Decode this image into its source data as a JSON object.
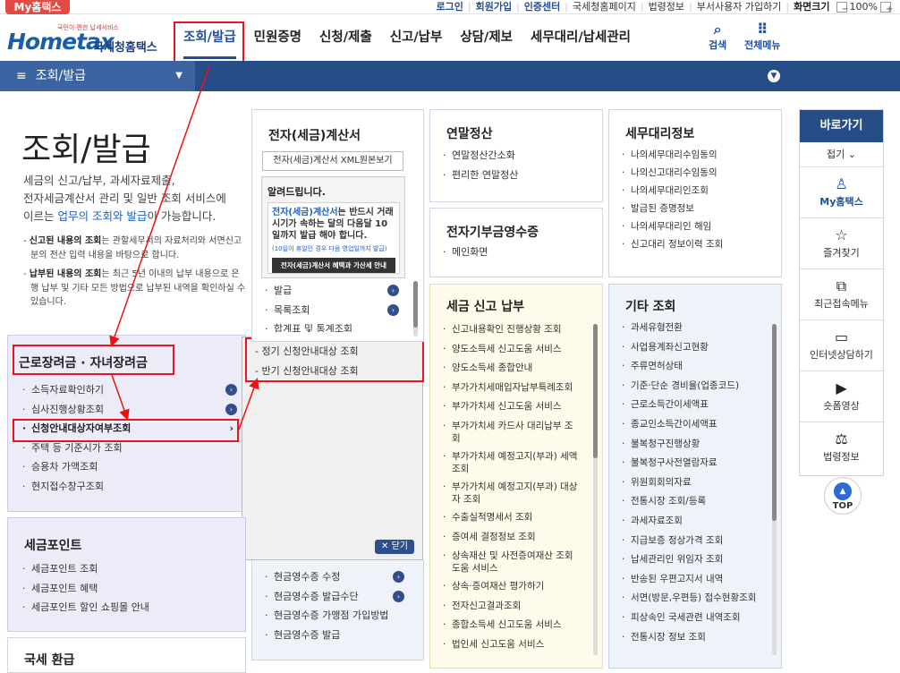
{
  "topbar": {
    "brand": "My홈택스",
    "links": [
      "로그인",
      "회원가입",
      "인증센터",
      "국세청홈페이지",
      "법령정보",
      "부서사용자 가입하기",
      "화면크기"
    ],
    "zoom": "100%",
    "zoom_out": "−",
    "zoom_in": "+"
  },
  "header": {
    "logo_small": "국민이 편한 납세서비스",
    "logo_main": "Hometax",
    "logo_sub": "국세청홈택스",
    "menu": [
      "조회/발급",
      "민원증명",
      "신청/제출",
      "신고/납부",
      "상담/제보",
      "세무대리/납세관리"
    ],
    "search_label": "검색",
    "allmenu_label": "전체메뉴"
  },
  "navbar": {
    "crumb": "조회/발급"
  },
  "page": {
    "title": "조회/발급",
    "desc_1": "세금의 신고/납부, 과세자료제출,",
    "desc_2": "전자세금계산서 관리 및 일반 조회 서비스에",
    "desc_3a": "이르는 ",
    "desc_3b": "업무의 조회와 발급",
    "desc_3c": "이 가능합니다.",
    "note1_bold": "신고된 내용의 조회",
    "note1_rest": "는 관할세무서의 자료처리와 서면신고분의 전산 입력 내용을 바탕으로 합니다.",
    "note2_bold": "납부된 내용의 조회",
    "note2_rest": "는 최근 5년 이내의 납부 내용으로 은행 납부 및 기타 모든 방법으로 납부된 내역을 확인하실 수 있습니다."
  },
  "box_labor": {
    "title": "근로장려금 · 자녀장려금",
    "items": [
      "소득자료확인하기",
      "심사진행상황조회",
      "신청안내대상자여부조회",
      "주택 등 기준시가 조회",
      "승용차 가액조회",
      "현지접수창구조회"
    ]
  },
  "popup": {
    "items": [
      "- 정기 신청안내대상 조회",
      "- 반기 신청안내대상 조회"
    ],
    "close": "닫기"
  },
  "box_point": {
    "title": "세금포인트",
    "items": [
      "세금포인트 조회",
      "세금포인트 혜택",
      "세금포인트 할인 쇼핑몰 안내"
    ]
  },
  "box_refund": {
    "title": "국세 환급"
  },
  "box_einvoice": {
    "title": "전자(세금)계산서",
    "xml_btn": "전자(세금)계산서 XML원본보기",
    "notice_title": "알려드립니다.",
    "notice_line1a": "전자(세금)계산서",
    "notice_line1b": "는 반드시 거래시기가 속하는 달의 다음달 10일까지 발급 해야 합니다.",
    "notice_small": "(10일이 휴일인 경우 다음 영업일까지 발급)",
    "notice_dark": "전자(세금)계산서 혜택과 가산세 안내",
    "items": [
      "발급",
      "목록조회",
      "합계표 및 통계조회"
    ]
  },
  "box_cash": {
    "items": [
      "현금영수증 수정",
      "현금영수증 발급수단",
      "현금영수증 가맹점 가입방법",
      "현금영수증 발급"
    ]
  },
  "box_yearend": {
    "title": "연말정산",
    "items": [
      "연말정산간소화",
      "편리한 연말정산"
    ]
  },
  "box_donation": {
    "title": "전자기부금영수증",
    "items": [
      "메인화면"
    ]
  },
  "box_taxreport": {
    "title": "세금 신고 납부",
    "items": [
      "신고내용확인 진행상황 조회",
      "양도소득세 신고도움 서비스",
      "양도소득세 종합안내",
      "부가가치세매입자납부특례조회",
      "부가가치세 신고도움 서비스",
      "부가가치세 카드사 대리납부 조회",
      "부가가치세 예정고지(부과) 세액조회",
      "부가가치세 예정고지(부과) 대상자 조회",
      "수출실적명세서 조회",
      "증여세 결정정보 조회",
      "상속재산 및 사전증여재산 조회 도움 서비스",
      "상속·증여재산 평가하기",
      "전자신고결과조회",
      "종합소득세 신고도움 서비스",
      "법인세 신고도움 서비스"
    ]
  },
  "box_agent": {
    "title": "세무대리정보",
    "items": [
      "나의세무대리수임동의",
      "나의신고대리수임동의",
      "나의세무대리인조회",
      "발급된 증명정보",
      "나의세무대리인 해임",
      "신고대리 정보이력 조회"
    ]
  },
  "box_etc": {
    "title": "기타 조회",
    "items": [
      "과세유형전환",
      "사업용계좌신고현황",
      "주류면허상태",
      "기준·단순 경비율(업종코드)",
      "근로소득간이세액표",
      "종교인소득간이세액표",
      "불복청구진행상황",
      "불복청구사전열람자료",
      "위원회회의자료",
      "전통시장 조회/등록",
      "과세자료조회",
      "지급보증 정상가격 조회",
      "납세관리인 위임자 조회",
      "반송된 우편고지서 내역",
      "서면(방문,우편등) 접수현황조회",
      "피상속인 국세관련 내역조회",
      "전통시장 정보 조회"
    ]
  },
  "sidebar": {
    "title": "바로가기",
    "fold": "접기",
    "items": [
      "My홈택스",
      "즐겨찾기",
      "최근접속메뉴",
      "인터넷상담하기",
      "숏폼영상",
      "법령정보"
    ],
    "top": "TOP"
  },
  "colors": {
    "brand_blue": "#274d86",
    "highlight_red": "#e11122",
    "tag_red": "#e34a43"
  }
}
